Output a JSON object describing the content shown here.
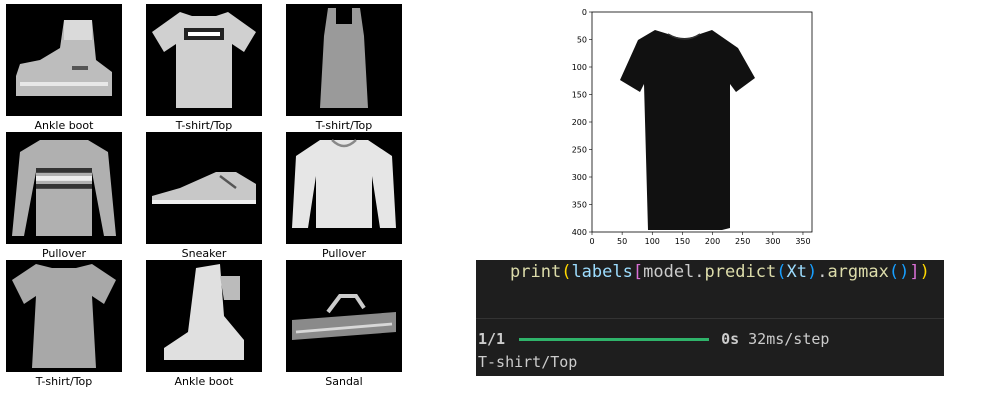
{
  "samples": [
    {
      "label": "Ankle boot",
      "icon": "ankle-boot-image"
    },
    {
      "label": "T-shirt/Top",
      "icon": "tshirt-image"
    },
    {
      "label": "T-shirt/Top",
      "icon": "tank-top-image"
    },
    {
      "label": "Pullover",
      "icon": "striped-pullover-image"
    },
    {
      "label": "Sneaker",
      "icon": "sneaker-image"
    },
    {
      "label": "Pullover",
      "icon": "pullover-image"
    },
    {
      "label": "T-shirt/Top",
      "icon": "tshirt-image"
    },
    {
      "label": "Ankle boot",
      "icon": "ankle-boot-image"
    },
    {
      "label": "Sandal",
      "icon": "sandal-image"
    }
  ],
  "plot": {
    "x_ticks": [
      "0",
      "50",
      "100",
      "150",
      "200",
      "250",
      "300",
      "350"
    ],
    "y_ticks": [
      "0",
      "50",
      "100",
      "150",
      "200",
      "250",
      "300",
      "350",
      "400"
    ],
    "image": "black-tshirt-photo"
  },
  "terminal": {
    "code": {
      "fn": "print",
      "p1": "(",
      "var": "labels",
      "b1": "[",
      "obj": "model",
      "dot1": ".",
      "method": "predict",
      "p2": "(",
      "arg": "Xt",
      "p3": ")",
      "dot2": ".",
      "method2": "argmax",
      "p4": "()",
      "b2": "]",
      "p5": ")"
    },
    "progress_step": "1/1",
    "progress_time": "0s",
    "progress_rate": "32ms/step",
    "progress_fraction": 1.0,
    "result": "T-shirt/Top"
  },
  "colors": {
    "terminal_bg": "#1e1e1e",
    "progress": "#2fb36a",
    "paren_outer": "#ffd700",
    "paren_mid": "#da70d6",
    "paren_inner": "#179fff",
    "identifier": "#cccccc"
  }
}
